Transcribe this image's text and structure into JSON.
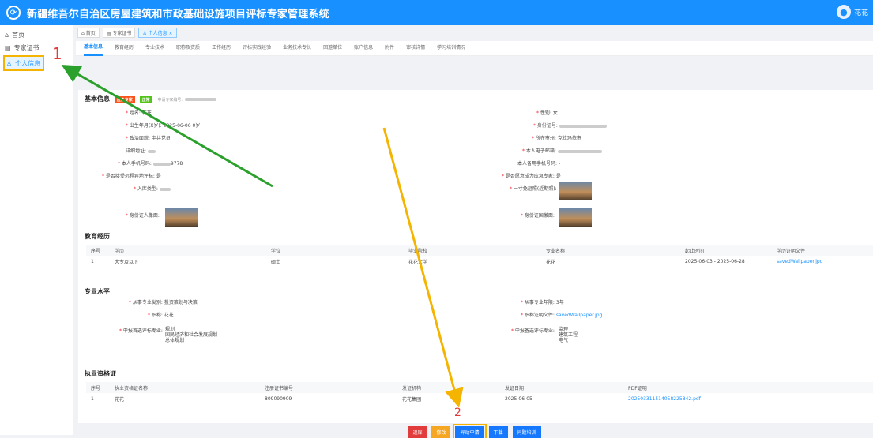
{
  "app": {
    "title": "新疆维吾尔自治区房屋建筑和市政基础设施项目评标专家管理系统",
    "user_name": "花花"
  },
  "sidebar": {
    "items": [
      {
        "label": "首页",
        "icon": "home-icon"
      },
      {
        "label": "专家证书",
        "icon": "certificate-icon"
      },
      {
        "label": "个人信息",
        "icon": "user-icon"
      }
    ]
  },
  "tagsbar": {
    "tags": [
      {
        "label": "首页",
        "icon": "home-icon"
      },
      {
        "label": "专家证书",
        "icon": "certificate-icon"
      },
      {
        "label": "个人信息 ×",
        "icon": "user-icon"
      }
    ]
  },
  "tabs": [
    "基本信息",
    "教育经历",
    "专业技术",
    "职称及资质",
    "工作经历",
    "评标实践经验",
    "业务技术专长",
    "回避单位",
    "账户信息",
    "附件",
    "审核详情",
    "学习培训情况"
  ],
  "basic": {
    "title": "基本信息",
    "badges": [
      "应急专家",
      "正常"
    ],
    "apply_no_label": "申请专家编号:",
    "name_label": "姓名:",
    "name": "花花",
    "gender_label": "性别:",
    "gender": "女",
    "birth_label": "出生年月(X岁):",
    "birth": "2025-06-06 0岁",
    "idno_label": "身份证号:",
    "politics_label": "政治面貌:",
    "politics": "中共党员",
    "city_label": "所在市州:",
    "city": "克拉玛依市",
    "address_label": "详细地址:",
    "email_label": "本人电子邮箱:",
    "phone_label": "本人手机号码:",
    "phone_suffix": "9778",
    "backup_phone_label": "本人备用手机号码:",
    "backup_phone": "-",
    "remote_label": "是否接受远程异地评标:",
    "remote": "是",
    "emergency_label": "是否愿意成为应急专家:",
    "emergency": "是",
    "type_label": "入库类型:",
    "photo_label": "一寸免冠照(近期照):",
    "id_front_label": "身份证人像面:",
    "id_back_label": "身份证国徽面:"
  },
  "education": {
    "title": "教育经历",
    "headers": [
      "序号",
      "学历",
      "学位",
      "毕业院校",
      "专业名称",
      "起止时间",
      "学历证明文件"
    ],
    "rows": [
      [
        "1",
        "大专及以下",
        "硕士",
        "花花大学",
        "花花",
        "2025-06-03 - 2025-06-28",
        "savedWallpaper.jpg"
      ]
    ]
  },
  "professional": {
    "title": "专业水平",
    "field_label": "从事专业类别:",
    "field": "投资策划与决策",
    "years_label": "从事专业年限:",
    "years": "3年",
    "title_label": "职称:",
    "title_value": "花花",
    "cert_file_label": "职称证明文件:",
    "cert_file": "savedWallpaper.jpg",
    "primary_label": "申报首选评标专业:",
    "primary": [
      "规划",
      "国民经济和社会发展规划",
      "总体规划"
    ],
    "secondary_label": "申报备选评标专业:",
    "secondary": [
      "监理",
      "建筑工程",
      "电气"
    ]
  },
  "license": {
    "title": "执业资格证",
    "headers": [
      "序号",
      "执业资格证名称",
      "注册证书编号",
      "发证机构",
      "发证日期",
      "PDF证明"
    ],
    "rows": [
      [
        "1",
        "花花",
        "809090909",
        "花花集团",
        "2025-06-05",
        "20250331151405822584​2.pdf"
      ]
    ]
  },
  "actions": [
    "退库",
    "修改",
    "异动申请",
    "下载",
    "问题培训"
  ],
  "annotations": [
    "1",
    "2"
  ],
  "colors": {
    "primary": "#1890ff",
    "highlight": "#f5b400",
    "arrow_green": "#2ca02c",
    "danger": "#e23b3b"
  }
}
